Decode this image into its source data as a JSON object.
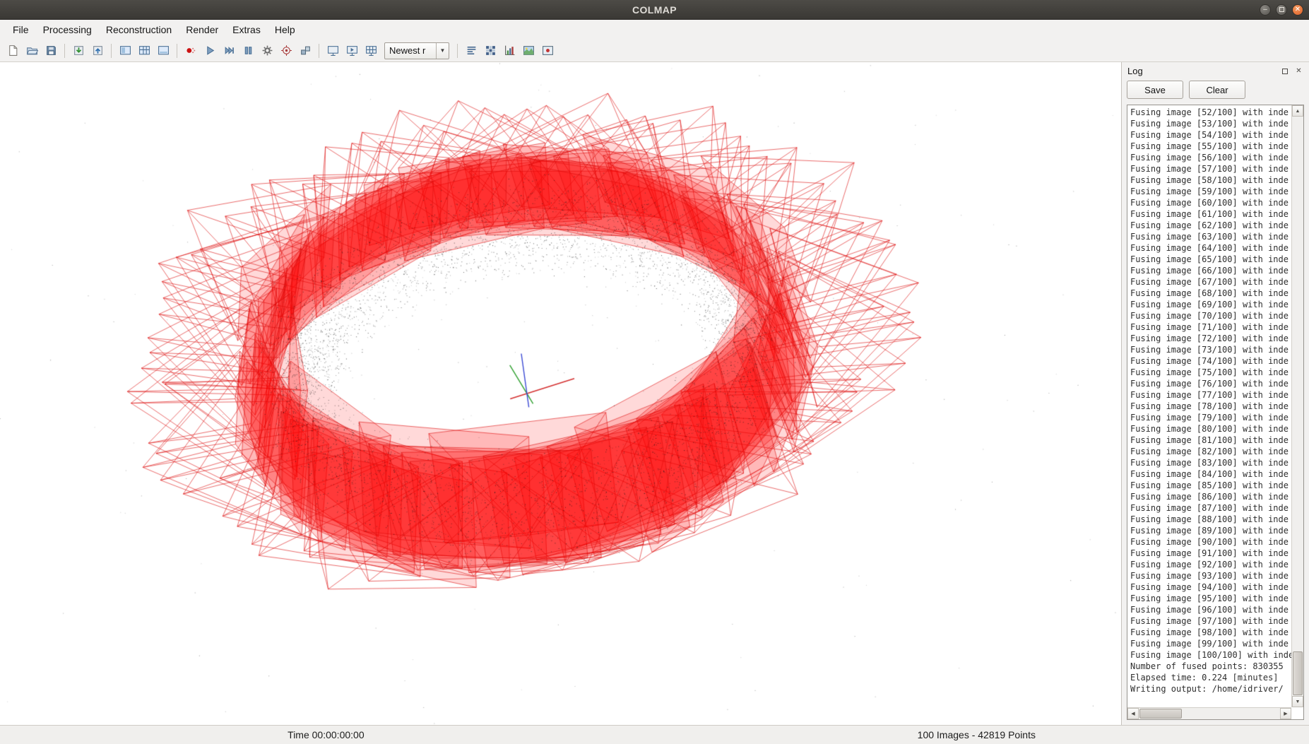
{
  "window": {
    "title": "COLMAP"
  },
  "menu": {
    "items": [
      "File",
      "Processing",
      "Reconstruction",
      "Render",
      "Extras",
      "Help"
    ]
  },
  "toolbar": {
    "model_selector_value": "Newest r",
    "icons": [
      "new-project-icon",
      "open-project-icon",
      "save-project-icon",
      "import-model-icon",
      "export-model-icon",
      "feature-extraction-icon",
      "feature-matching-icon",
      "database-management-icon",
      "render-reset-icon",
      "reconstruction-start-icon",
      "reconstruction-step-icon",
      "reconstruction-pause-icon",
      "reconstruction-options-icon",
      "bundle-adjustment-icon",
      "dense-reconstruction-icon",
      "render-screen-icon",
      "render-movie-icon",
      "render-grid-icon",
      "show-log-icon",
      "match-matrix-icon",
      "statistics-icon",
      "grab-image-icon",
      "grab-movie-icon",
      "dropdown-arrow-icon"
    ]
  },
  "log_panel": {
    "title": "Log",
    "save_label": "Save",
    "clear_label": "Clear",
    "fusing": {
      "prefix": "Fusing image [",
      "suffix": "/100] with inde",
      "start": 52,
      "end": 100
    },
    "tail_lines": [
      "Number of fused points: 830355",
      "Elapsed time: 0.224 [minutes]",
      "Writing output: /home/idriver/"
    ]
  },
  "status_bar": {
    "time": "Time 00:00:00:00",
    "info": "100 Images - 42819 Points"
  },
  "viewport": {
    "background": "#ffffff",
    "num_cameras": 100,
    "num_cloud_points": 6500,
    "num_outlier_points": 300,
    "frustum_fill": "rgba(255,0,0,0.15)",
    "frustum_stroke": "rgba(222,12,12,0.60)",
    "point_color": "25,25,25",
    "axis_colors": {
      "x": "#d42f2f",
      "y": "#2fa02f",
      "z": "#3a49d4"
    },
    "view": {
      "azimuth": 15,
      "elevation": 51,
      "roll": 8,
      "persp": 55,
      "scale_ratio": 0.0325,
      "center_x": 0.47,
      "center_y": 0.5
    },
    "seed": 987654
  }
}
